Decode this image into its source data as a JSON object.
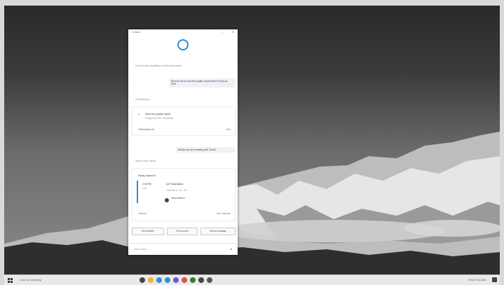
{
  "cortana": {
    "title": "Cortana",
    "prompt_text": "Go from ask everything to scheduled events",
    "user_msg_1": "Remind me to send the quality report before Friday at 9PM",
    "reply_1": "I'll remind you",
    "reminder_title": "Send the quality report",
    "reminder_time": "Friday 9:00 PM · Reminder",
    "reminder_action": "Reminder set",
    "reminder_link": "Edit",
    "user_msg_2": "What's my next meeting with Olivia?",
    "reply_2": "Here's what I found",
    "agenda_date": "Friday, March 8",
    "event_time": "2:00 PM",
    "event_duration": "1 hr",
    "event_title": "Q2 Presentation",
    "event_location": "Conf Rm 2 / 41 / 26",
    "event_person": "Olivia Wilson",
    "agenda_footer_left": "Outlook",
    "agenda_footer_right": "See calendar",
    "chip_1": "Set reminder",
    "chip_2": "Find a room",
    "chip_3": "Send a message",
    "input_placeholder": "Ask Cortana",
    "accent": "#2b8fd6"
  },
  "taskbar": {
    "search_placeholder": "Ask me anything",
    "tray_text": "ENG  9:41 AM",
    "app_colors": [
      "#444444",
      "#f2b233",
      "#2b8fd6",
      "#2b8fd6",
      "#6b5ad6",
      "#d9534f",
      "#2e7d32",
      "#444444",
      "#555555"
    ]
  }
}
